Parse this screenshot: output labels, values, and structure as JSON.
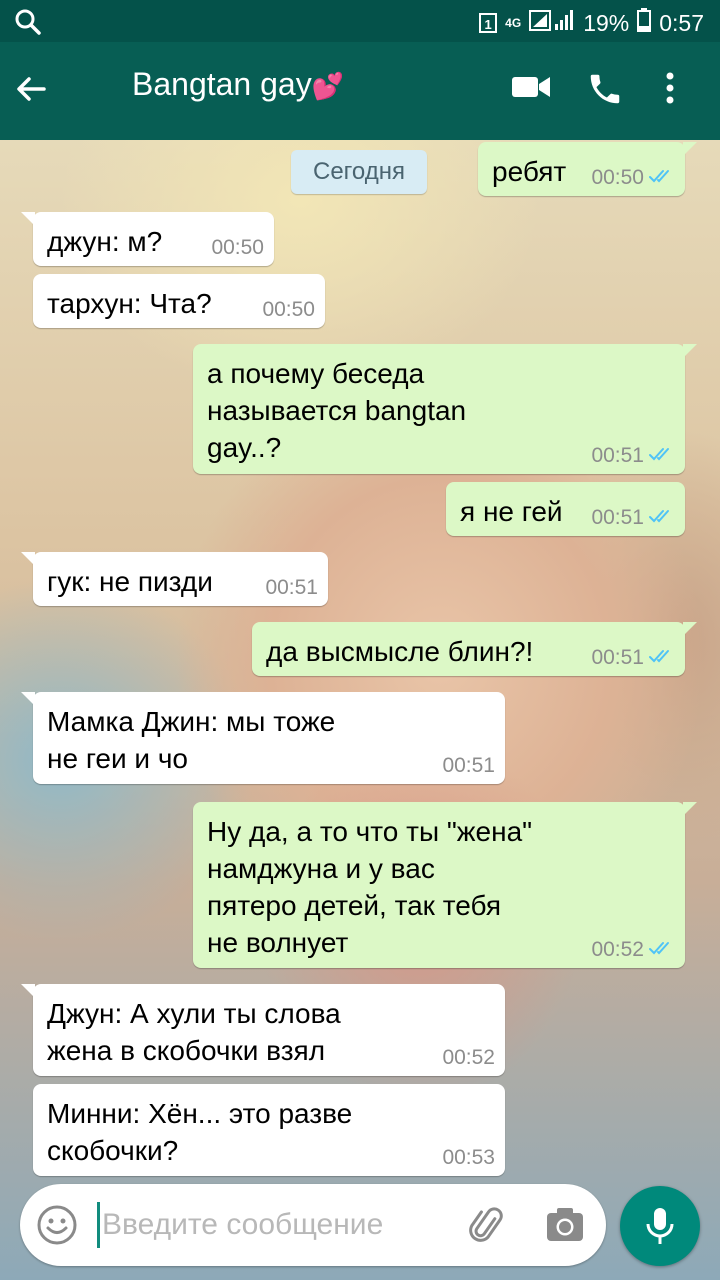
{
  "status_bar": {
    "sim": "1",
    "network": "4G",
    "battery": "19%",
    "time": "0:57"
  },
  "header": {
    "title": "Bangtan gay",
    "emoji": "💕"
  },
  "date_chip": "Сегодня",
  "messages": [
    {
      "dir": "out",
      "lines": [
        "ребят"
      ],
      "time": "00:50",
      "read": true
    },
    {
      "dir": "in",
      "lines": [
        "джун: м?"
      ],
      "time": "00:50"
    },
    {
      "dir": "in",
      "lines": [
        "тархун: Чта?"
      ],
      "time": "00:50"
    },
    {
      "dir": "out",
      "lines": [
        "а почему беседа",
        "называется bangtan",
        "gay..?"
      ],
      "time": "00:51",
      "read": true
    },
    {
      "dir": "out",
      "lines": [
        "я не гей"
      ],
      "time": "00:51",
      "read": true
    },
    {
      "dir": "in",
      "lines": [
        "гук: не пизди"
      ],
      "time": "00:51"
    },
    {
      "dir": "out",
      "lines": [
        "да высмысле блин?!"
      ],
      "time": "00:51",
      "read": true
    },
    {
      "dir": "in",
      "lines": [
        "Мамка Джин: мы тоже",
        "не геи и чо"
      ],
      "time": "00:51"
    },
    {
      "dir": "out",
      "lines": [
        "Ну да, а то что ты \"жена\"",
        "намджуна и у вас",
        "пятеро детей, так тебя",
        "не волнует"
      ],
      "time": "00:52",
      "read": true
    },
    {
      "dir": "in",
      "lines": [
        "Джун: А хули ты слова",
        "жена в скобочки взял"
      ],
      "time": "00:52"
    },
    {
      "dir": "in",
      "lines": [
        "Минни: Хён... это разве",
        "скобочки?"
      ],
      "time": "00:53"
    }
  ],
  "input": {
    "placeholder": "Введите сообщение",
    "value": ""
  },
  "colors": {
    "header": "#075e54",
    "status_bar": "#04524a",
    "outgoing": "#dcf8c6",
    "incoming": "#ffffff",
    "ticks": "#4fc3f7",
    "fab": "#00897b"
  }
}
